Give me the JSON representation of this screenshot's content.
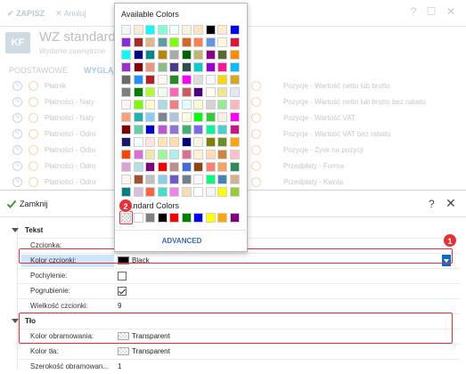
{
  "colors": {
    "accent": "#0b6cc8",
    "highlight": "#e53238",
    "selected_row": "#cde6fb"
  },
  "toolbar": {
    "save_label": "ZAPISZ",
    "cancel_label": "Anuluj"
  },
  "header": {
    "logo_text": "KF",
    "title": "WZ standard",
    "subtitle": "Wydanie zewnętrzne"
  },
  "tabs": [
    "PODSTAWOWE",
    "WYGLĄD"
  ],
  "bg_rows_left": [
    "Płatnik",
    "Płatności - Naty",
    "Płatności - Naty",
    "Płatności - Odro",
    "Płatności - Odro",
    "Płatności - Odro",
    "Płatności - Odro",
    "Płatności - Odro"
  ],
  "bg_rows_right": [
    "Pozycje - Wartość netto lub brutto",
    "Pozycje - Wartość netto lub brutto bez rabatu",
    "Pozycje - Wartość VAT",
    "Pozycje - Wartość VAT bez rabatu",
    "Pozycje - Zysk na pozycji",
    "Przedpłaty - Forma",
    "Przedpłaty - Kwota"
  ],
  "dialog": {
    "close_label": "Zamknij",
    "help_icon": "?",
    "close_icon": "✕"
  },
  "properties": {
    "tekst": {
      "category": "Tekst",
      "czcionka_label": "Czcionka:",
      "kolor_label": "Kolor czcionki:",
      "kolor_value": "Black",
      "kolor_color": "#000000",
      "pochylenie_label": "Pochylenie:",
      "pogrubienie_label": "Pogrubienie:",
      "wielkosc_label": "Wielkość czcionki:",
      "wielkosc_value": "9"
    },
    "tlo": {
      "category": "Tło",
      "obramowanie_label": "Kolor obramowania:",
      "obramowanie_value": "Transparent",
      "tlo_label": "Kolor tła:",
      "tlo_value": "Transparent",
      "szerokosc_label": "Szerokość obramowan...",
      "szerokosc_value": "1"
    }
  },
  "picker": {
    "available_title": "Available Colors",
    "standard_title": "Standard Colors",
    "advanced_label": "ADVANCED",
    "palette_rows": [
      [
        "#f0f8ff",
        "#faebd7",
        "#00ffff",
        "#7fffd4",
        "#f0ffff",
        "#f5f5dc",
        "#ffe4c4",
        "#000000",
        "#ffebcd",
        "#0000ff"
      ],
      [
        "#8a2be2",
        "#a52a2a",
        "#deb887",
        "#5f9ea0",
        "#7fff00",
        "#d2691e",
        "#ff7f50",
        "#6495ed",
        "#fff8dc",
        "#dc143c"
      ],
      [
        "#00ffff",
        "#00008b",
        "#008b8b",
        "#b8860b",
        "#a9a9a9",
        "#006400",
        "#bdb76b",
        "#8b008b",
        "#556b2f",
        "#ff8c00"
      ],
      [
        "#9932cc",
        "#8b0000",
        "#e9967a",
        "#8fbc8f",
        "#483d8b",
        "#2f4f4f",
        "#00ced1",
        "#9400d3",
        "#ff1493",
        "#00bfff"
      ],
      [
        "#696969",
        "#1e90ff",
        "#b22222",
        "#fffaf0",
        "#228b22",
        "#ff00ff",
        "#dcdcdc",
        "#f8f8ff",
        "#ffd700",
        "#daa520"
      ],
      [
        "#808080",
        "#008000",
        "#adff2f",
        "#f0fff0",
        "#ff69b4",
        "#cd5c5c",
        "#4b0082",
        "#fffff0",
        "#f0e68c",
        "#e6e6fa"
      ],
      [
        "#fff0f5",
        "#7cfc00",
        "#fffacd",
        "#add8e6",
        "#f08080",
        "#e0ffff",
        "#fafad2",
        "#d3d3d3",
        "#90ee90",
        "#ffb6c1"
      ],
      [
        "#ffa07a",
        "#20b2aa",
        "#87cefa",
        "#778899",
        "#b0c4de",
        "#ffffe0",
        "#00ff00",
        "#32cd32",
        "#faf0e6",
        "#ff00ff"
      ],
      [
        "#800000",
        "#66cdaa",
        "#0000cd",
        "#ba55d3",
        "#9370db",
        "#3cb371",
        "#7b68ee",
        "#00fa9a",
        "#48d1cc",
        "#c71585"
      ],
      [
        "#191970",
        "#f5fffa",
        "#ffe4e1",
        "#ffe4b5",
        "#ffdead",
        "#000080",
        "#fdf5e6",
        "#808000",
        "#6b8e23",
        "#ffa500"
      ],
      [
        "#ff4500",
        "#da70d6",
        "#eee8aa",
        "#98fb98",
        "#afeeee",
        "#db7093",
        "#ffefd5",
        "#ffdab9",
        "#cd853f",
        "#ffc0cb"
      ],
      [
        "#dda0dd",
        "#b0e0e6",
        "#800080",
        "#ff0000",
        "#bc8f8f",
        "#4169e1",
        "#8b4513",
        "#fa8072",
        "#f4a460",
        "#2e8b57"
      ],
      [
        "#fff5ee",
        "#a0522d",
        "#c0c0c0",
        "#87ceeb",
        "#6a5acd",
        "#708090",
        "#fffafa",
        "#00ff7f",
        "#4682b4",
        "#d2b48c"
      ],
      [
        "#008080",
        "#d8bfd8",
        "#ff6347",
        "#40e0d0",
        "#ee82ee",
        "#f5deb3",
        "#ffffff",
        "#f5f5f5",
        "#ffff00",
        "#9acd32"
      ]
    ],
    "standard_colors": [
      "transparent",
      "#ffffff",
      "#808080",
      "#000000",
      "#ff0000",
      "#008000",
      "#0000ff",
      "#ffff00",
      "#ffa500",
      "#800080"
    ]
  },
  "badges": {
    "one": "1",
    "two": "2"
  }
}
